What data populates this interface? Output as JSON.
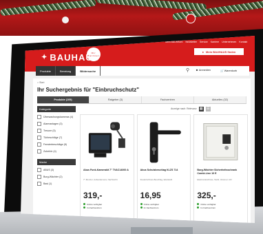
{
  "colors": {
    "brand_red": "#d61c1c",
    "dark": "#333333",
    "bezel": "#0c0c0c"
  },
  "header": {
    "logo_text": "BAUHAUS",
    "logo_badge": "Ihr Partner",
    "utility_links": [
      "Mein BAUHAUS",
      "Newsletter",
      "Service",
      "Karriere",
      "Unternehmen",
      "Kontakt"
    ],
    "store_button": "Mein BAUHAUS finden",
    "account_label": "Anmelden",
    "cart_label": "Warenkorb",
    "icons": {
      "search": "search-icon",
      "account": "user-icon",
      "cart": "cart-icon",
      "store": "pin-icon"
    }
  },
  "nav": {
    "tabs": [
      "Produkte",
      "Beratung",
      "Bildersuche"
    ],
    "active_index": 2
  },
  "content": {
    "breadcrumb": "Start",
    "page_title": "Ihr Suchergebnis für \"Einbruchschutz\"",
    "result_tabs": [
      "Produkte (109)",
      "Ratgeber (3)",
      "Fachzentren",
      "Aktuelles (32)"
    ],
    "active_result_tab": 0,
    "sort_label": "Anzeige nach: Relevanz",
    "filters": [
      {
        "heading": "Kategorie",
        "items": [
          "Überwachungskameras (4)",
          "Alarmanlagen (3)",
          "Tresore (5)",
          "Türbeschläge (7)",
          "Fensterbeschläge (8)",
          "Zubehör (4)"
        ]
      },
      {
        "heading": "Marke",
        "items": [
          "ABUS (3)",
          "Burg-Wächter (2)",
          "Basi (1)"
        ]
      }
    ],
    "products": [
      {
        "name": "Abus Funk-Kamerakit 7\" TVAC14000 A",
        "desc": "7\"-Monitor, Außenkamera, Nachtsicht",
        "price": "319,-",
        "availability": [
          "Online verfügbar",
          "Im Fachcentrum"
        ]
      },
      {
        "name": "Abus Schutzbeschlag KLZS 714",
        "desc": "Zusatzschloss-Beschlag, Edelstahl",
        "price": "16,95",
        "availability": [
          "Online verfügbar",
          "Im Fachcentrum"
        ]
      },
      {
        "name": "Burg-Wächter Sicherheitsschrank Combi-Line 10 E",
        "desc": "Elektronikschloss, Stahl, Volumen 10 l",
        "price": "325,-",
        "availability": [
          "Online verfügbar",
          "Im Fachcentrum"
        ]
      }
    ]
  }
}
